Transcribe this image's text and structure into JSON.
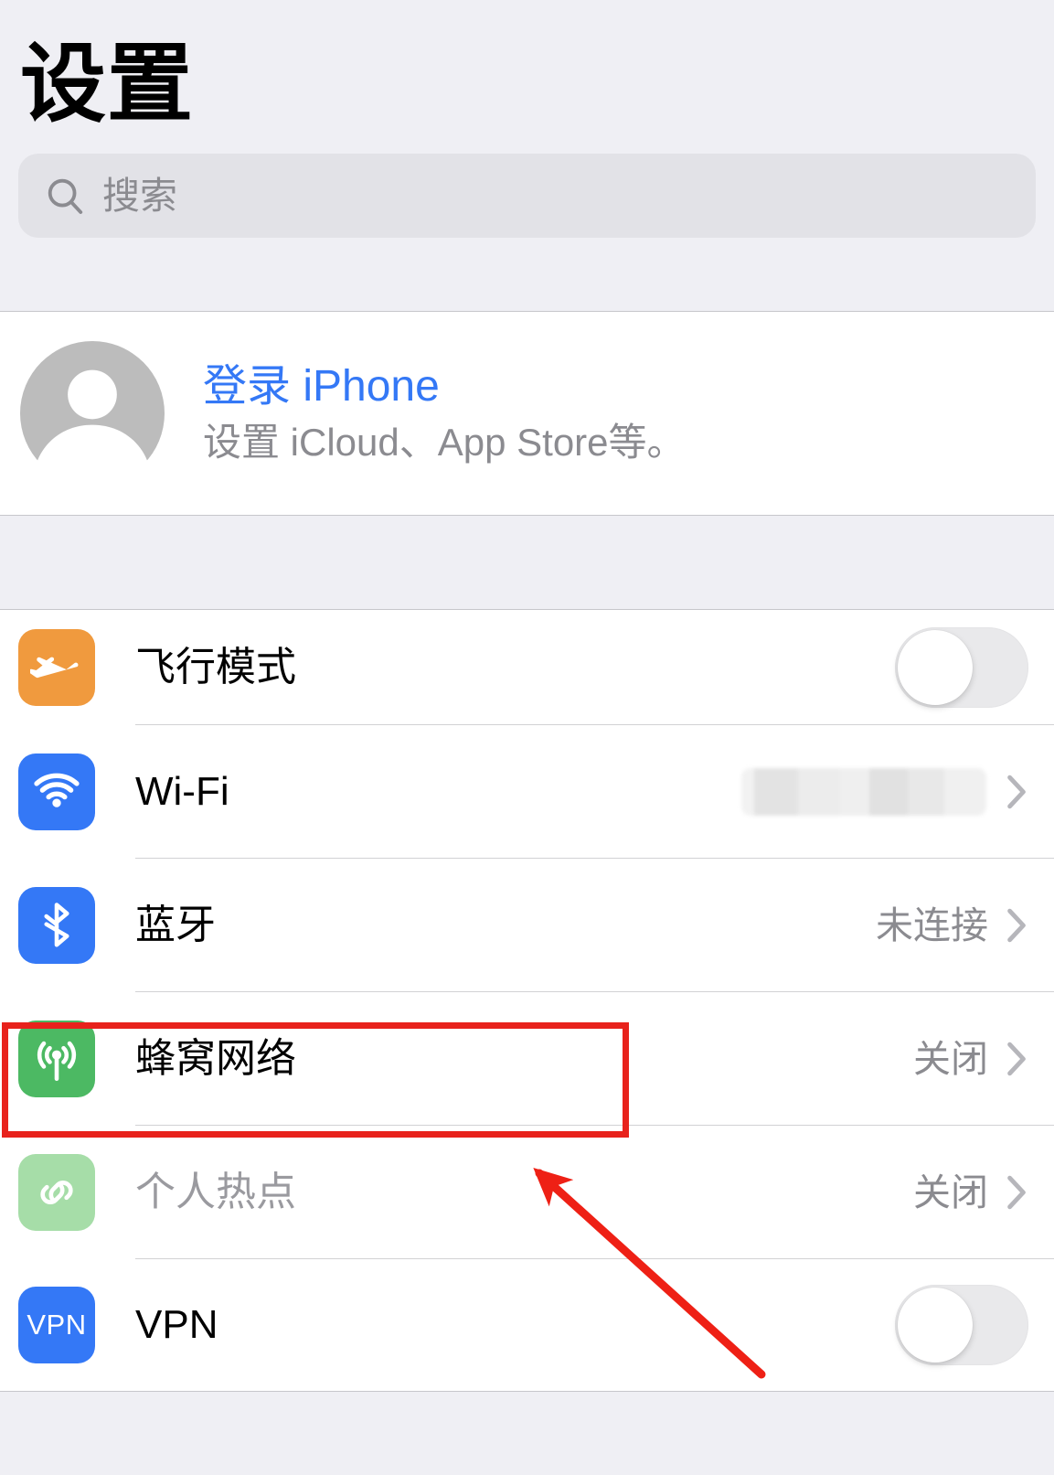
{
  "header": {
    "title": "设置",
    "search": {
      "placeholder": "搜索",
      "value": "",
      "icon": "search-icon"
    }
  },
  "account": {
    "avatar_icon": "person-avatar-icon",
    "title": "登录 iPhone",
    "subtitle": "设置 iCloud、App Store等。",
    "title_color": "#3478f6"
  },
  "connectivity": {
    "rows": [
      {
        "label": "飞行模式",
        "icon": "airplane-icon",
        "icon_color": "#f09a3e",
        "control": "toggle",
        "toggle_on": false,
        "value": "",
        "disabled": false
      },
      {
        "label": "Wi-Fi",
        "icon": "wifi-icon",
        "icon_color": "#3478f6",
        "control": "chevron",
        "value": "",
        "value_redacted": true,
        "disabled": false
      },
      {
        "label": "蓝牙",
        "icon": "bluetooth-icon",
        "icon_color": "#3478f6",
        "control": "chevron",
        "value": "未连接",
        "disabled": false
      },
      {
        "label": "蜂窝网络",
        "icon": "cellular-icon",
        "icon_color": "#4cb963",
        "control": "chevron",
        "value": "关闭",
        "disabled": false,
        "highlighted": true
      },
      {
        "label": "个人热点",
        "icon": "personal-hotspot-icon",
        "icon_color": "#a6dda8",
        "control": "chevron",
        "value": "关闭",
        "disabled": true
      },
      {
        "label": "VPN",
        "icon": "vpn-icon",
        "icon_color": "#3478f6",
        "control": "toggle",
        "toggle_on": false,
        "value": "",
        "disabled": false
      }
    ]
  },
  "annotations": {
    "highlight_color": "#e8221c",
    "box_target": "蜂窝网络",
    "arrow_points_to": "蜂窝网络"
  }
}
